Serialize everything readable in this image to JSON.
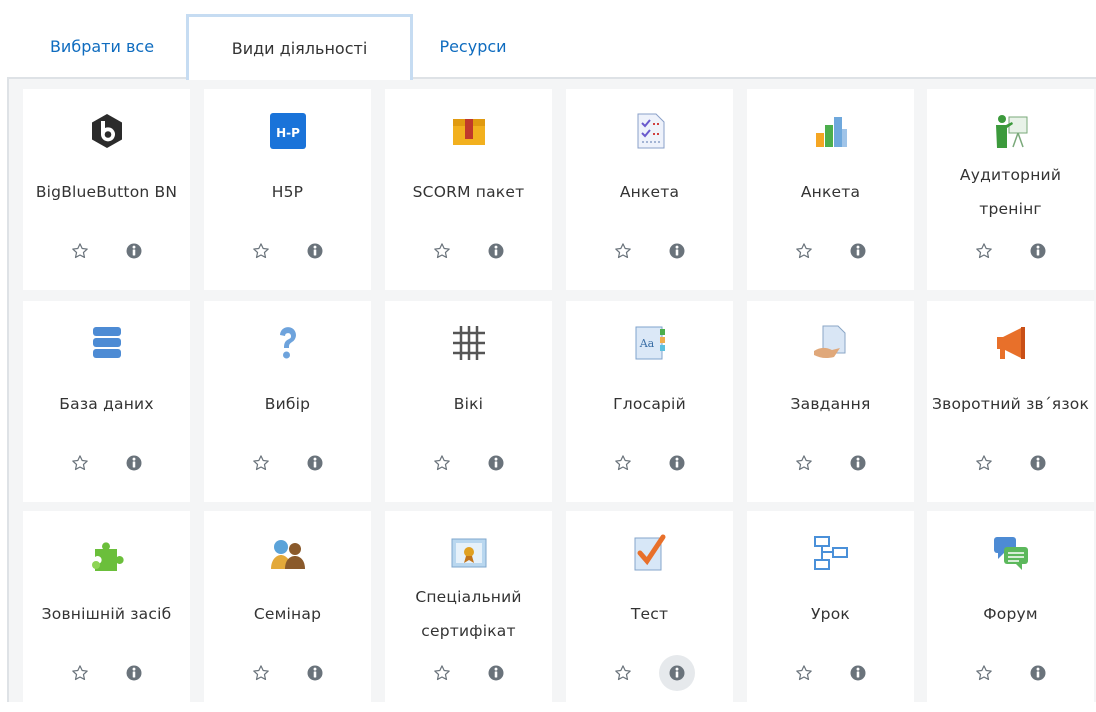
{
  "tabs": [
    {
      "label": "Вибрати все"
    },
    {
      "label": "Види діяльності"
    },
    {
      "label": "Ресурси"
    }
  ],
  "activities": [
    {
      "name": "BigBlueButton BN",
      "icon": "bigbluebutton-icon"
    },
    {
      "name": "H5P",
      "icon": "h5p-icon"
    },
    {
      "name": "SCORM пакет",
      "icon": "scorm-package-icon"
    },
    {
      "name": "Анкета",
      "icon": "questionnaire-icon"
    },
    {
      "name": "Анкета",
      "icon": "survey-chart-icon"
    },
    {
      "name": "Аудиторний тренінг",
      "icon": "classroom-training-icon"
    },
    {
      "name": "База даних",
      "icon": "database-icon"
    },
    {
      "name": "Вибір",
      "icon": "choice-icon"
    },
    {
      "name": "Вікі",
      "icon": "wiki-icon"
    },
    {
      "name": "Глосарій",
      "icon": "glossary-icon"
    },
    {
      "name": "Завдання",
      "icon": "assignment-icon"
    },
    {
      "name": "Зворотний зв´язок",
      "icon": "feedback-icon"
    },
    {
      "name": "Зовнішній засіб",
      "icon": "external-tool-icon"
    },
    {
      "name": "Семінар",
      "icon": "workshop-icon"
    },
    {
      "name": "Спеціальний сертифікат",
      "icon": "custom-certificate-icon"
    },
    {
      "name": "Тест",
      "icon": "quiz-icon"
    },
    {
      "name": "Урок",
      "icon": "lesson-icon"
    },
    {
      "name": "Форум",
      "icon": "forum-icon"
    }
  ],
  "colors": {
    "link": "#0f6cbf",
    "active_tab_border": "#c6dcf2",
    "panel": "#f4f5f6"
  }
}
